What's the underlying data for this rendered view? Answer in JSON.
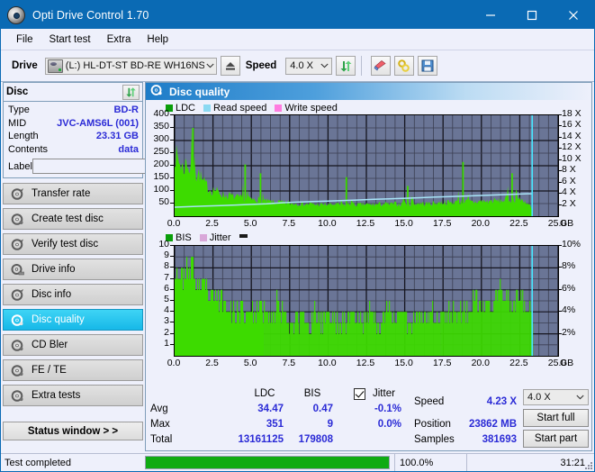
{
  "window": {
    "title": "Opti Drive Control 1.70",
    "icon": "disc-icon",
    "minimize": "minimize-icon",
    "maximize": "maximize-icon",
    "close": "close-icon"
  },
  "menu": {
    "items": [
      "File",
      "Start test",
      "Extra",
      "Help"
    ]
  },
  "toolbar": {
    "drive_label": "Drive",
    "drive_value": "(L:)  HL-DT-ST BD-RE  WH16NS58 TST4",
    "eject_icon": "eject-icon",
    "speed_label": "Speed",
    "speed_value": "4.0 X",
    "refresh_icon": "refresh-icon",
    "erase_icon": "eraser-icon",
    "tools_icon": "keys-icon",
    "save_icon": "floppy-save-icon"
  },
  "disc": {
    "title": "Disc",
    "refresh_icon": "refresh-icon",
    "rows": [
      {
        "key": "Type",
        "value": "BD-R"
      },
      {
        "key": "MID",
        "value": "JVC-AMS6L (001)"
      },
      {
        "key": "Length",
        "value": "23.31 GB"
      },
      {
        "key": "Contents",
        "value": "data"
      }
    ],
    "label_key": "Label",
    "label_value": "",
    "label_placeholder": "",
    "cd_icon": "disc-icon"
  },
  "nav": {
    "items": [
      {
        "label": "Transfer rate",
        "icon": "disc-test-icon",
        "active": false
      },
      {
        "label": "Create test disc",
        "icon": "disc-burn-icon",
        "active": false
      },
      {
        "label": "Verify test disc",
        "icon": "disc-verify-icon",
        "active": false
      },
      {
        "label": "Drive info",
        "icon": "disc-drive-icon",
        "active": false
      },
      {
        "label": "Disc info",
        "icon": "disc-info-icon",
        "active": false
      },
      {
        "label": "Disc quality",
        "icon": "disc-quality-icon",
        "active": true
      },
      {
        "label": "CD Bler",
        "icon": "disc-bler-icon",
        "active": false
      },
      {
        "label": "FE / TE",
        "icon": "disc-fete-icon",
        "active": false
      },
      {
        "label": "Extra tests",
        "icon": "disc-extra-icon",
        "active": false
      }
    ],
    "status_window": "Status window > >"
  },
  "panel": {
    "title": "Disc quality",
    "title_icon": "disc-quality-icon"
  },
  "stats": {
    "col_ldc": "LDC",
    "col_bis": "BIS",
    "jitter_label": "Jitter",
    "jitter_checked": true,
    "rows": [
      {
        "label": "Avg",
        "ldc": "34.47",
        "bis": "0.47",
        "jitter": "-0.1%"
      },
      {
        "label": "Max",
        "ldc": "351",
        "bis": "9",
        "jitter": "0.0%"
      },
      {
        "label": "Total",
        "ldc": "13161125",
        "bis": "179808",
        "jitter": ""
      }
    ],
    "speed_label": "Speed",
    "speed_value": "4.23 X",
    "position_label": "Position",
    "position_value": "23862 MB",
    "samples_label": "Samples",
    "samples_value": "381693",
    "speed_select": "4.0 X",
    "start_full": "Start full",
    "start_part": "Start part"
  },
  "statusbar": {
    "text": "Test completed",
    "percent": "100.0%",
    "progress": 100,
    "time": "31:21"
  },
  "colors": {
    "titlebar": "#0a6ab4",
    "accent_value": "#2b2bd6",
    "plot_bg": "#6a7596",
    "ldc_green": "#0a9e0a",
    "bar_green": "#3ddb00",
    "read_speed": "#8ad9f2",
    "write_speed": "#ff7de0",
    "bis_green": "#0a9e0a",
    "jitter_pink": "#d9a8d9",
    "progress_green": "#0fab12",
    "nav_active": "#16b8e8"
  },
  "chart_data": [
    {
      "type": "area",
      "id": "ldc-chart",
      "title": "",
      "legend": [
        {
          "label": "LDC",
          "color": "#0a9e0a"
        },
        {
          "label": "Read speed",
          "color": "#8ad9f2"
        },
        {
          "label": "Write speed",
          "color": "#ff7de0"
        }
      ],
      "legend_position": "top-left",
      "xlabel": "GB",
      "ylabel": "",
      "xlim": [
        0,
        25.0
      ],
      "xticks": [
        0.0,
        2.5,
        5.0,
        7.5,
        10.0,
        12.5,
        15.0,
        17.5,
        20.0,
        22.5,
        25.0
      ],
      "xticklabels": [
        "0.0",
        "2.5",
        "5.0",
        "7.5",
        "10.0",
        "12.5",
        "15.0",
        "17.5",
        "20.0",
        "22.5",
        "25.0"
      ],
      "ylim": [
        0,
        400
      ],
      "yticks": [
        50,
        100,
        150,
        200,
        250,
        300,
        350,
        400
      ],
      "yticklabels": [
        "50",
        "100",
        "150",
        "200",
        "250",
        "300",
        "350",
        "400"
      ],
      "y2label": "X",
      "y2lim": [
        0,
        18
      ],
      "y2ticks": [
        2,
        4,
        6,
        8,
        10,
        12,
        14,
        16,
        18
      ],
      "y2ticklabels": [
        "2 X",
        "4 X",
        "6 X",
        "8 X",
        "10 X",
        "12 X",
        "14 X",
        "16 X",
        "18 X"
      ],
      "grid": true,
      "data_end_x": 23.31,
      "series": [
        {
          "name": "LDC",
          "color": "#3ddb00",
          "axis": "left",
          "x": [
            0.0,
            0.2,
            0.4,
            0.6,
            0.8,
            1.0,
            1.2,
            1.4,
            1.6,
            1.8,
            2.0,
            2.2,
            2.4,
            2.6,
            2.8,
            3.0,
            3.2,
            3.4,
            3.6,
            3.8,
            4.0,
            4.2,
            4.4,
            4.6,
            4.8,
            5.0,
            5.2,
            5.4,
            5.6,
            5.8,
            6.0,
            6.2,
            6.4,
            6.6,
            6.8,
            7.0,
            7.2,
            7.4,
            7.6,
            7.8,
            8.0,
            8.2,
            8.4,
            8.6,
            8.8,
            9.0,
            9.2,
            9.4,
            9.6,
            9.8,
            10.0,
            10.4,
            10.8,
            11.2,
            11.6,
            12.0,
            12.4,
            12.8,
            13.2,
            13.6,
            14.0,
            14.4,
            14.8,
            15.2,
            15.6,
            16.0,
            16.4,
            16.8,
            17.2,
            17.6,
            18.0,
            18.4,
            18.8,
            19.2,
            19.6,
            20.0,
            20.4,
            20.8,
            21.2,
            21.6,
            22.0,
            22.4,
            22.8,
            23.2,
            23.31
          ],
          "y": [
            230,
            215,
            190,
            175,
            210,
            160,
            350,
            150,
            160,
            130,
            120,
            105,
            95,
            100,
            90,
            85,
            80,
            75,
            78,
            72,
            70,
            68,
            66,
            205,
            64,
            62,
            60,
            58,
            170,
            56,
            55,
            54,
            52,
            50,
            52,
            50,
            48,
            50,
            46,
            48,
            46,
            48,
            46,
            44,
            46,
            44,
            42,
            44,
            42,
            44,
            42,
            44,
            42,
            155,
            44,
            42,
            44,
            42,
            44,
            46,
            44,
            46,
            44,
            120,
            46,
            48,
            46,
            48,
            50,
            52,
            50,
            52,
            215,
            54,
            52,
            56,
            54,
            58,
            56,
            60,
            170,
            62,
            58,
            35,
            20
          ],
          "note": "green filled area; peaks up to 351 max"
        },
        {
          "name": "Read speed",
          "color": "#a8e4f7",
          "axis": "right",
          "x": [
            0.0,
            1.0,
            2.0,
            3.0,
            4.0,
            5.0,
            6.0,
            7.0,
            8.0,
            9.0,
            10.0,
            11.0,
            12.0,
            13.0,
            14.0,
            15.0,
            16.0,
            17.0,
            18.0,
            19.0,
            20.0,
            21.0,
            22.0,
            23.0,
            23.31
          ],
          "y": [
            1.6,
            1.7,
            1.8,
            1.9,
            2.0,
            2.1,
            2.2,
            2.4,
            2.5,
            2.6,
            2.7,
            2.8,
            2.9,
            3.0,
            3.1,
            3.2,
            3.3,
            3.4,
            3.5,
            3.6,
            3.7,
            3.8,
            3.9,
            4.0,
            4.0
          ]
        },
        {
          "name": "Write speed",
          "color": "#ff7de0",
          "axis": "right",
          "x": [],
          "y": []
        }
      ]
    },
    {
      "type": "bar",
      "id": "bis-chart",
      "title": "",
      "legend": [
        {
          "label": "BIS",
          "color": "#0a9e0a"
        },
        {
          "label": "Jitter",
          "color": "#d9a8d9"
        }
      ],
      "legend_position": "top-left",
      "xlabel": "GB",
      "ylabel": "",
      "xlim": [
        0,
        25.0
      ],
      "xticks": [
        0.0,
        2.5,
        5.0,
        7.5,
        10.0,
        12.5,
        15.0,
        17.5,
        20.0,
        22.5,
        25.0
      ],
      "xticklabels": [
        "0.0",
        "2.5",
        "5.0",
        "7.5",
        "10.0",
        "12.5",
        "15.0",
        "17.5",
        "20.0",
        "22.5",
        "25.0"
      ],
      "ylim": [
        0,
        10
      ],
      "yticks": [
        1,
        2,
        3,
        4,
        5,
        6,
        7,
        8,
        9,
        10
      ],
      "yticklabels": [
        "1",
        "2",
        "3",
        "4",
        "5",
        "6",
        "7",
        "8",
        "9",
        "10"
      ],
      "y2label": "%",
      "y2lim": [
        0,
        10
      ],
      "y2ticks": [
        2,
        4,
        6,
        8,
        10
      ],
      "y2ticklabels": [
        "2%",
        "4%",
        "6%",
        "8%",
        "10%"
      ],
      "grid": true,
      "data_end_x": 23.31,
      "series": [
        {
          "name": "BIS",
          "color": "#3ddb00",
          "axis": "left",
          "x": [
            0.1,
            0.3,
            0.5,
            0.7,
            0.9,
            1.1,
            1.3,
            1.5,
            1.7,
            1.9,
            2.1,
            2.3,
            2.5,
            2.7,
            2.9,
            3.1,
            3.3,
            3.5,
            3.7,
            3.9,
            4.1,
            4.3,
            4.5,
            4.7,
            4.9,
            5.1,
            5.3,
            5.5,
            5.7,
            5.9,
            6.1,
            6.3,
            6.5,
            6.7,
            6.9,
            7.1,
            7.3,
            7.5,
            7.7,
            7.9,
            8.1,
            8.3,
            8.5,
            8.7,
            8.9,
            9.1,
            9.3,
            9.5,
            9.7,
            9.9,
            10.3,
            10.7,
            11.1,
            11.5,
            11.9,
            12.3,
            12.7,
            13.1,
            13.5,
            13.9,
            14.3,
            14.7,
            15.1,
            15.5,
            15.9,
            16.3,
            16.7,
            17.1,
            17.5,
            17.9,
            18.3,
            18.7,
            19.1,
            19.5,
            19.9,
            20.3,
            20.7,
            21.1,
            21.5,
            21.9,
            22.3,
            22.7,
            23.1,
            23.31
          ],
          "y": [
            8,
            7,
            7,
            8,
            7,
            9,
            6,
            7,
            6,
            6,
            6,
            5,
            5,
            5,
            5,
            5,
            4,
            5,
            4,
            4,
            4,
            4,
            4,
            4,
            4,
            4,
            4,
            4,
            4,
            4,
            3,
            4,
            3,
            6,
            4,
            4,
            3,
            3,
            3,
            4,
            3,
            4,
            3,
            3,
            3,
            4,
            3,
            3,
            3,
            4,
            3,
            3,
            3,
            4,
            3,
            3,
            4,
            3,
            3,
            4,
            3,
            4,
            3,
            3,
            4,
            3,
            4,
            3,
            4,
            4,
            4,
            4,
            4,
            5,
            4,
            5,
            4,
            6,
            5,
            5,
            5,
            5,
            4,
            3
          ]
        },
        {
          "name": "Jitter",
          "color": "#d9a8d9",
          "axis": "right",
          "x": [],
          "y": []
        }
      ]
    }
  ]
}
